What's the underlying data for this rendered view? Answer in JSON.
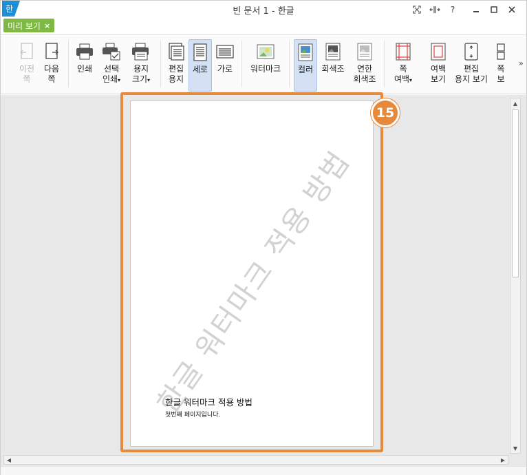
{
  "window": {
    "title": "빈 문서 1 - 한글",
    "app_logo_char": "한",
    "controls": {
      "fullscreen": "⛶",
      "splitter": "+||+",
      "help": "?",
      "minimize": "—",
      "maximize": "□",
      "close": "✕"
    }
  },
  "mode_tab": {
    "label": "미리 보기",
    "close": "×"
  },
  "ribbon": {
    "prev_page": {
      "line1": "이전",
      "line2": "쪽",
      "icon": "prev-page-icon"
    },
    "next_page": {
      "line1": "다음",
      "line2": "쪽",
      "icon": "next-page-icon"
    },
    "print": {
      "line1": "인쇄",
      "icon": "printer-icon"
    },
    "select_print": {
      "line1": "선택",
      "line2": "인쇄",
      "icon": "select-print-icon"
    },
    "paper_size": {
      "line1": "용지",
      "line2": "크기",
      "icon": "paper-size-icon"
    },
    "edit_paper": {
      "line1": "편집",
      "line2": "용지",
      "icon": "edit-paper-icon"
    },
    "portrait": {
      "line1": "세로",
      "icon": "portrait-icon"
    },
    "landscape": {
      "line1": "가로",
      "icon": "landscape-icon"
    },
    "watermark": {
      "line1": "워터마크",
      "icon": "watermark-icon"
    },
    "color": {
      "line1": "컬러",
      "icon": "color-icon"
    },
    "grayscale": {
      "line1": "회색조",
      "icon": "grayscale-icon"
    },
    "light_gray": {
      "line1": "연한",
      "line2": "회색조",
      "icon": "light-grayscale-icon"
    },
    "page_margin": {
      "line1": "쪽",
      "line2": "여백",
      "icon": "page-margin-icon"
    },
    "margin_view": {
      "line1": "여백",
      "line2": "보기",
      "icon": "margin-view-icon"
    },
    "edit_paper_view": {
      "line1": "편집",
      "line2": "용지 보기",
      "icon": "edit-paper-view-icon"
    },
    "cut_item": {
      "line1": "쪽",
      "line2": "보",
      "icon": "multi-page-icon"
    },
    "overflow": "»",
    "dropdown_caret": "▾"
  },
  "document": {
    "watermark_text": "한글 워터마크 적용 방법",
    "title": "한글 워터마크 적용 방법",
    "subtitle": "첫번째 페이지입니다."
  },
  "annotation": {
    "step_number": "15",
    "color": "#e68a3c"
  },
  "scroll": {
    "up": "▲",
    "down": "▼",
    "left": "◀",
    "right": "▶"
  }
}
